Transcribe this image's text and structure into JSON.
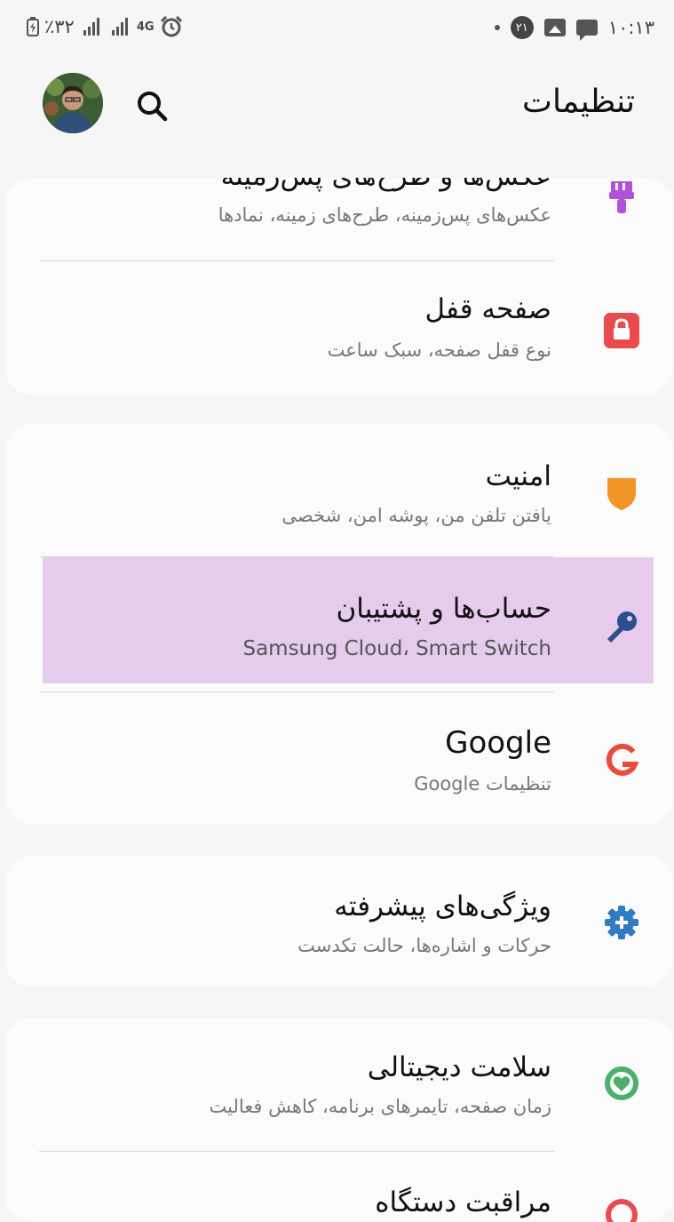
{
  "status_bar": {
    "battery_percent": "٪۳۲",
    "network": "4G",
    "notification_count": "۲۱",
    "time": "۱۰:۱۳"
  },
  "header": {
    "title": "تنظیمات"
  },
  "items": [
    {
      "title": "عکس‌ها و طرح‌های پس‌زمینه",
      "subtitle": "عکس‌های پس‌زمینه، طرح‌های زمینه، نمادها",
      "icon": "brush-icon",
      "color": "#b352d8"
    },
    {
      "title": "صفحه قفل",
      "subtitle": "نوع قفل صفحه، سبک ساعت",
      "icon": "lock-icon",
      "color": "#e84c4f"
    },
    {
      "title": "امنیت",
      "subtitle": "یافتن تلفن من، پوشه امن، شخصی",
      "icon": "shield-icon",
      "color": "#f39427"
    },
    {
      "title": "حساب‌ها و پشتیبان",
      "subtitle": "Samsung Cloud، Smart Switch",
      "icon": "key-icon",
      "color": "#2c4e8c"
    },
    {
      "title": "Google",
      "subtitle": "تنظیمات Google",
      "icon": "google-icon",
      "color": "#e94b3c"
    },
    {
      "title": "ویژگی‌های پیشرفته",
      "subtitle": "حرکات و اشاره‌ها، حالت تکدست",
      "icon": "gear-plus-icon",
      "color": "#2f7bc4"
    },
    {
      "title": "سلامت دیجیتالی",
      "subtitle": "زمان صفحه، تایمرهای برنامه، کاهش فعالیت",
      "icon": "digital-wellbeing-icon",
      "color": "#4caf6a"
    },
    {
      "title": "مراقبت دستگاه",
      "subtitle": "",
      "icon": "device-care-icon",
      "color": "#e84c4f"
    }
  ]
}
